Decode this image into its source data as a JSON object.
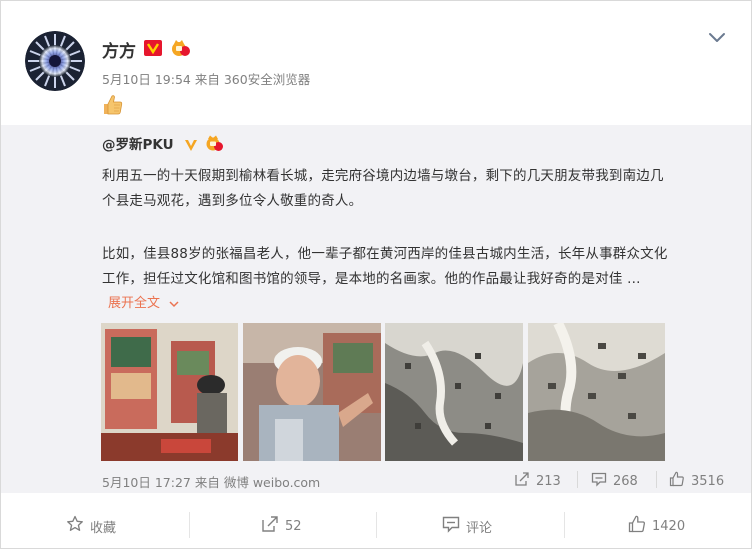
{
  "post": {
    "author": "方方",
    "time": "5月10日 19:54",
    "source_prefix": "来自",
    "source": "360安全浏览器"
  },
  "repost": {
    "user": "@罗新PKU",
    "lines": [
      "利用五一的十天假期到榆林看长城，走完府谷境内边墙与墩台，剩下的几天朋友带我到南边几",
      "个县走马观花，遇到多位令人敬重的奇人。",
      "比如，佳县88岁的张福昌老人，他一辈子都在黄河西岸的佳县古城内生活，长年从事群众文化",
      "工作，担任过文化馆和图书馆的领导，是本地的名画家。他的作品最让我好奇的是对佳 ..."
    ],
    "expand_label": "展开全文",
    "time": "5月10日 17:27",
    "source_prefix": "来自",
    "source": "微博 weibo.com",
    "repost_count": "213",
    "comment_count": "268",
    "like_count": "3516"
  },
  "actions": {
    "favorite_label": "收藏",
    "repost_count": "52",
    "comment_label": "评论",
    "like_count": "1420"
  },
  "colors": {
    "link_orange": "#eb7350",
    "meta_gray": "#808080",
    "repost_bg": "#f2f2f5"
  }
}
